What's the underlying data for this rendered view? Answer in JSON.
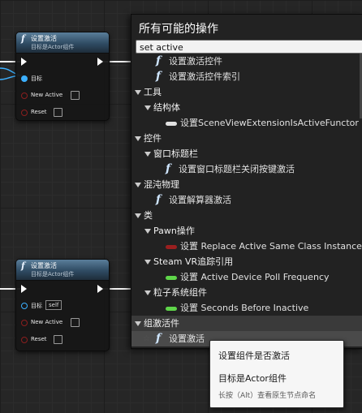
{
  "nodes": [
    {
      "title": "设置激活",
      "subtitle": "目标是Actor组件",
      "target_label": "目标",
      "new_active_label": "New Active",
      "reset_label": "Reset"
    },
    {
      "title": "设置激活",
      "subtitle": "目标是Actor组件",
      "target_label": "目标",
      "target_value": "self",
      "new_active_label": "New Active",
      "reset_label": "Reset"
    }
  ],
  "panel": {
    "title": "所有可能的操作",
    "search_value": "set active",
    "items": [
      {
        "kind": "fn",
        "indent": 1,
        "label": "设置激活控件"
      },
      {
        "kind": "fn",
        "indent": 1,
        "label": "设置激活控件索引"
      },
      {
        "kind": "cat",
        "indent": 0,
        "label": "工具"
      },
      {
        "kind": "cat",
        "indent": 1,
        "label": "结构体"
      },
      {
        "kind": "var-white",
        "indent": 2,
        "label": "设置SceneViewExtensionIsActiveFunctor"
      },
      {
        "kind": "cat",
        "indent": 0,
        "label": "控件"
      },
      {
        "kind": "cat",
        "indent": 1,
        "label": "窗口标题栏"
      },
      {
        "kind": "fn",
        "indent": 2,
        "label": "设置窗口标题栏关闭按键激活"
      },
      {
        "kind": "cat",
        "indent": 0,
        "label": "混沌物理"
      },
      {
        "kind": "fn",
        "indent": 1,
        "label": "设置解算器激活"
      },
      {
        "kind": "cat",
        "indent": 0,
        "label": "类"
      },
      {
        "kind": "cat",
        "indent": 1,
        "label": "Pawn操作"
      },
      {
        "kind": "var-red",
        "indent": 2,
        "label": "设置 Replace Active Same Class Instance"
      },
      {
        "kind": "cat",
        "indent": 1,
        "label": "Steam VR追踪引用"
      },
      {
        "kind": "var-green",
        "indent": 2,
        "label": "设置 Active Device Poll Frequency"
      },
      {
        "kind": "cat",
        "indent": 1,
        "label": "粒子系统组件"
      },
      {
        "kind": "var-green",
        "indent": 2,
        "label": "设置 Seconds Before Inactive"
      },
      {
        "kind": "cat",
        "indent": 0,
        "label": "组激活件",
        "selected": true
      },
      {
        "kind": "fn",
        "indent": 1,
        "label": "设置激活",
        "star": true,
        "highlight": true
      }
    ]
  },
  "tooltip": {
    "line1": "设置组件是否激活",
    "line2": "目标是Actor组件",
    "line3": "长按（Alt）查看原生节点命名"
  },
  "colors": {
    "exec_pin": "#ffffff",
    "object_pin": "#3cb0ff",
    "bool_pin": "#8b1e1e",
    "var_red": "#9a1f1f",
    "var_green": "#5fd64a",
    "var_white": "#e0e0e0"
  }
}
